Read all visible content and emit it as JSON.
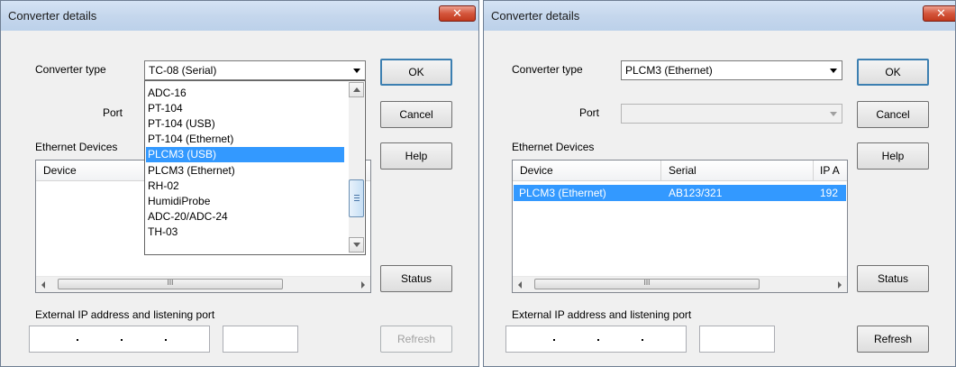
{
  "left": {
    "title": "Converter details",
    "converter_type_label": "Converter type",
    "converter_type_value": "TC-08 (Serial)",
    "port_label": "Port",
    "ethernet_label": "Ethernet Devices",
    "columns": [
      "Device"
    ],
    "dropdown_options": [
      "ADC-16",
      "PT-104",
      "PT-104 (USB)",
      "PT-104 (Ethernet)",
      "PLCM3 (USB)",
      "PLCM3 (Ethernet)",
      "RH-02",
      "HumidiProbe",
      "ADC-20/ADC-24",
      "TH-03"
    ],
    "highlighted_option": "PLCM3 (USB)",
    "external_ip_label": "External IP address and listening port",
    "scroll_grip": "III",
    "buttons": {
      "ok": "OK",
      "cancel": "Cancel",
      "help": "Help",
      "status": "Status",
      "refresh": "Refresh"
    }
  },
  "right": {
    "title": "Converter details",
    "converter_type_label": "Converter type",
    "converter_type_value": "PLCM3 (Ethernet)",
    "port_label": "Port",
    "port_value": "",
    "ethernet_label": "Ethernet Devices",
    "columns": [
      "Device",
      "Serial",
      "IP A"
    ],
    "rows": [
      {
        "device": "PLCM3 (Ethernet)",
        "serial": "AB123/321",
        "ip": "192"
      }
    ],
    "external_ip_label": "External IP address and listening port",
    "scroll_grip": "III",
    "buttons": {
      "ok": "OK",
      "cancel": "Cancel",
      "help": "Help",
      "status": "Status",
      "refresh": "Refresh"
    }
  },
  "close_glyph": "✕",
  "colors": {
    "selection": "#3399ff",
    "titlebar": "#c4d6ec",
    "close": "#c9452a"
  }
}
